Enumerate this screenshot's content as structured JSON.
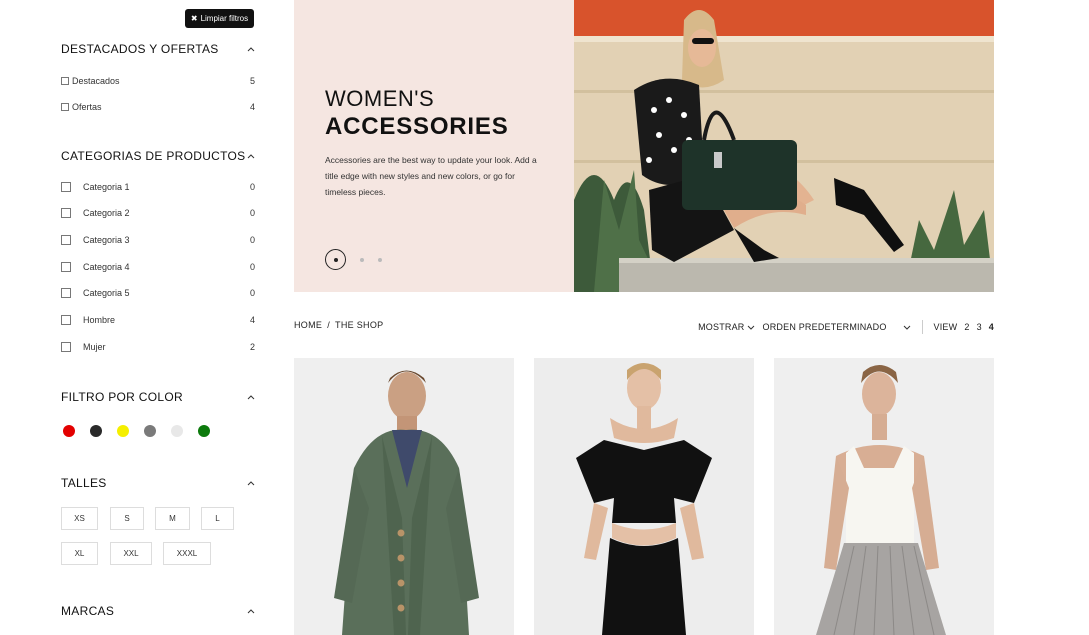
{
  "filters": {
    "clear_label": "Limpiar filtros",
    "featured": {
      "title": "DESTACADOS Y OFERTAS",
      "options": [
        {
          "label": "Destacados",
          "count": "5"
        },
        {
          "label": "Ofertas",
          "count": "4"
        }
      ]
    },
    "categories": {
      "title": "CATEGORIAS DE PRODUCTOS",
      "options": [
        {
          "label": "Categoria 1",
          "count": "0"
        },
        {
          "label": "Categoria 2",
          "count": "0"
        },
        {
          "label": "Categoria 3",
          "count": "0"
        },
        {
          "label": "Categoria 4",
          "count": "0"
        },
        {
          "label": "Categoria 5",
          "count": "0"
        },
        {
          "label": "Hombre",
          "count": "4"
        },
        {
          "label": "Mujer",
          "count": "2"
        }
      ]
    },
    "color": {
      "title": "FILTRO POR COLOR",
      "swatches": [
        "#e30000",
        "#2a2a2a",
        "#f5ef00",
        "#7a7a7a",
        "#e8e8e8",
        "#0c7a0c"
      ]
    },
    "sizes": {
      "title": "TALLES",
      "options": [
        "XS",
        "S",
        "M",
        "L",
        "XL",
        "XXL",
        "XXXL"
      ]
    },
    "brands": {
      "title": "MARCAS"
    }
  },
  "banner": {
    "title_line1": "WOMEN'S",
    "title_line2": "ACCESSORIES",
    "text": "Accessories are the best way to update your look. Add a title edge with new styles and new colors, or go for timeless pieces.",
    "bg_color": "#f5e6e1"
  },
  "toolbar": {
    "breadcrumb_home": "HOME",
    "breadcrumb_sep": "/",
    "breadcrumb_current": "THE SHOP",
    "show_label": "MOSTRAR",
    "sort_label": "ORDEN PREDETERMINADO",
    "view_label": "VIEW",
    "view_options": [
      "2",
      "3",
      "4"
    ]
  },
  "products": [
    {
      "icon": "man-green-cardigan-photo"
    },
    {
      "icon": "woman-black-dress-photo"
    },
    {
      "icon": "woman-white-top-pleated-skirt-photo"
    }
  ]
}
